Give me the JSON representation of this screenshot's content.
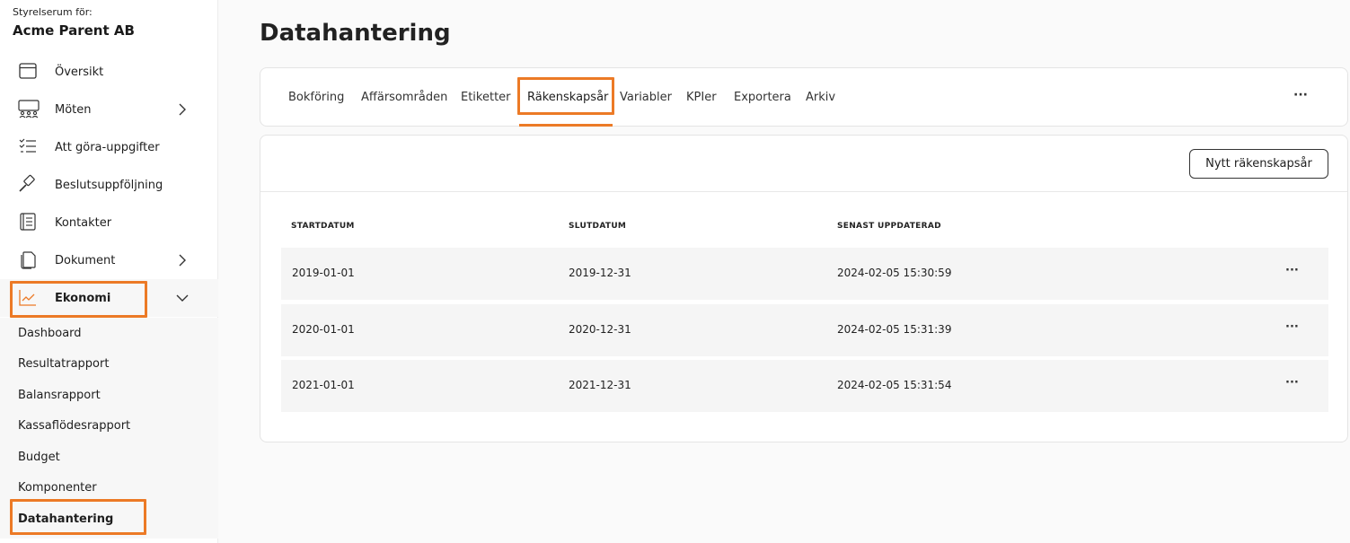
{
  "sidebar": {
    "org_label": "Styrelserum för:",
    "org_name": "Acme Parent AB",
    "items": [
      {
        "label": "Översikt",
        "icon": "calendar-icon"
      },
      {
        "label": "Möten",
        "icon": "meetings-icon"
      },
      {
        "label": "Att göra-uppgifter",
        "icon": "checklist-icon"
      },
      {
        "label": "Beslutsuppföljning",
        "icon": "gavel-icon"
      },
      {
        "label": "Kontakter",
        "icon": "contacts-book-icon"
      },
      {
        "label": "Dokument",
        "icon": "documents-icon"
      },
      {
        "label": "Ekonomi",
        "icon": "chart-line-icon"
      }
    ],
    "submenu": [
      {
        "label": "Dashboard"
      },
      {
        "label": "Resultatrapport"
      },
      {
        "label": "Balansrapport"
      },
      {
        "label": "Kassaflödesrapport"
      },
      {
        "label": "Budget"
      },
      {
        "label": "Komponenter"
      },
      {
        "label": "Datahantering"
      }
    ]
  },
  "main": {
    "title": "Datahantering",
    "tabs": [
      {
        "label": "Bokföring"
      },
      {
        "label": "Affärsområden"
      },
      {
        "label": "Etiketter"
      },
      {
        "label": "Räkenskapsår"
      },
      {
        "label": "Variabler"
      },
      {
        "label": "KPIer"
      },
      {
        "label": "Exportera"
      },
      {
        "label": "Arkiv"
      }
    ],
    "more": "···",
    "new_button": "Nytt räkenskapsår",
    "table": {
      "headers": [
        "STARTDATUM",
        "SLUTDATUM",
        "SENAST UPPDATERAD"
      ],
      "rows": [
        [
          "2019-01-01",
          "2019-12-31",
          "2024-02-05 15:30:59"
        ],
        [
          "2020-01-01",
          "2020-12-31",
          "2024-02-05 15:31:39"
        ],
        [
          "2021-01-01",
          "2021-12-31",
          "2024-02-05 15:31:54"
        ]
      ],
      "row_more": "···"
    }
  },
  "colors": {
    "accent": "#ec7a26",
    "text": "#1e1e1e",
    "row_bg": "#f5f5f5"
  }
}
